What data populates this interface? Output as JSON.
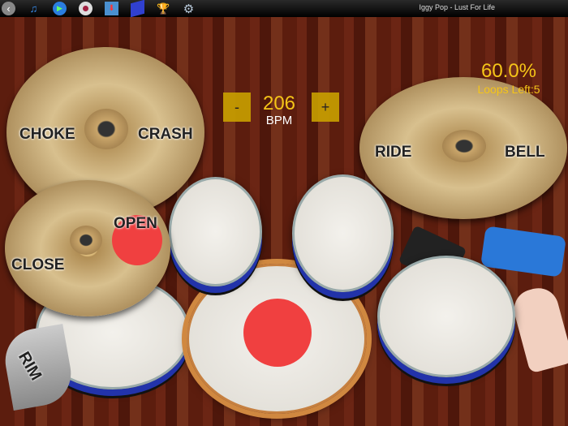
{
  "toolbar": {
    "icons": [
      "back-icon",
      "music-icon",
      "play-icon",
      "record-icon",
      "import-icon",
      "book-icon",
      "trophy-icon",
      "settings-icon"
    ],
    "song_title": "Iggy Pop - Lust For Life"
  },
  "tempo": {
    "minus_label": "-",
    "plus_label": "+",
    "bpm": "206",
    "bpm_label": "BPM"
  },
  "progress": {
    "percent": "60.0%",
    "loops_left": "Loops Left:5"
  },
  "pads": {
    "choke": "CHOKE",
    "crash": "CRASH",
    "ride": "RIDE",
    "bell": "BELL",
    "open": "OPEN",
    "close": "CLOSE",
    "rim": "RIM"
  },
  "colors": {
    "accent": "#f5c518",
    "hit": "#f04040"
  }
}
